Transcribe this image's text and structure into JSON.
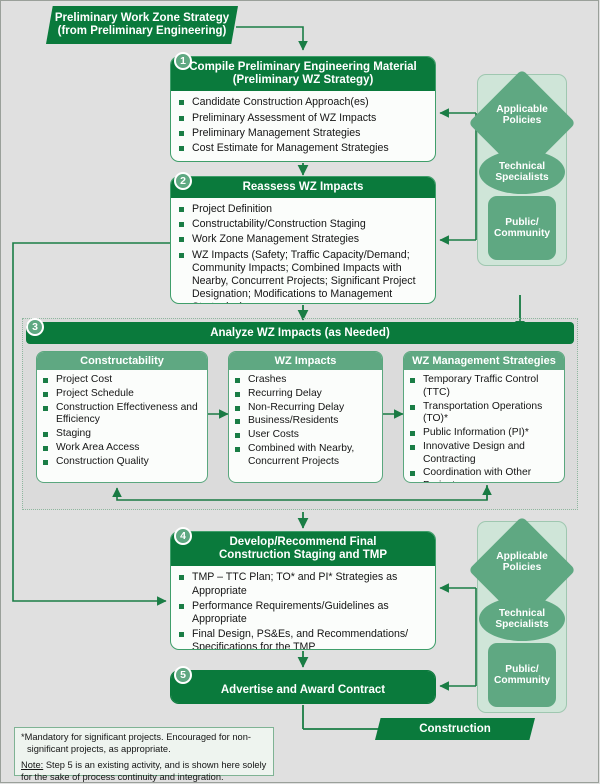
{
  "banners": {
    "top": "Preliminary Work Zone Strategy\n(from Preliminary Engineering)",
    "top_line1": "Preliminary Work Zone Strategy",
    "top_line2": "(from Preliminary Engineering)",
    "construction": "Construction"
  },
  "steps": [
    {
      "number": "1",
      "title_line1": "Compile Preliminary Engineering Material",
      "title_line2": "(Preliminary WZ Strategy)",
      "items": [
        "Candidate Construction Approach(es)",
        "Preliminary Assessment of WZ Impacts",
        "Preliminary Management Strategies",
        "Cost Estimate for Management Strategies"
      ]
    },
    {
      "number": "2",
      "title_line1": "Reassess WZ Impacts",
      "title_line2": "",
      "items": [
        "Project Definition",
        "Constructability/Construction Staging",
        "Work Zone Management Strategies",
        "WZ Impacts (Safety; Traffic Capacity/Demand; Community Impacts; Combined Impacts with Nearby, Concurrent Projects; Significant Project Designation; Modifications to Management Strategies)"
      ]
    },
    {
      "number": "3",
      "title_line1": "Analyze WZ Impacts (as Needed)",
      "title_line2": "",
      "items": []
    },
    {
      "number": "4",
      "title_line1": "Develop/Recommend Final",
      "title_line2": "Construction Staging and TMP",
      "items": [
        "TMP – TTC Plan; TO* and PI* Strategies as Appropriate",
        "Performance Requirements/Guidelines as Appropriate",
        "Final Design, PS&Es, and Recommendations/ Specifications for the TMP"
      ]
    },
    {
      "number": "5",
      "title_line1": "Advertise and Award Contract",
      "title_line2": "",
      "items": []
    }
  ],
  "step3_subpanels": [
    {
      "title": "Constructability",
      "items": [
        "Project Cost",
        "Project Schedule",
        "Construction Effectiveness and Efficiency",
        "Staging",
        "Work Area Access",
        "Construction Quality"
      ]
    },
    {
      "title": "WZ Impacts",
      "items": [
        "Crashes",
        "Recurring Delay",
        "Non-Recurring Delay",
        "Business/Residents",
        "User Costs",
        "Combined with Nearby, Concurrent Projects"
      ]
    },
    {
      "title": "WZ Management Strategies",
      "items": [
        "Temporary Traffic Control (TTC)",
        "Transportation Operations (TO)*",
        "Public Information (PI)*",
        "Innovative Design and Contracting",
        "Coordination with Other Projects"
      ]
    }
  ],
  "resources": {
    "top": {
      "diamond": "Applicable\nPolicies",
      "diamond_line1": "Applicable",
      "diamond_line2": "Policies",
      "ellipse_line1": "Technical",
      "ellipse_line2": "Specialists",
      "rect_line1": "Public/",
      "rect_line2": "Community"
    },
    "bottom": {
      "diamond_line1": "Applicable",
      "diamond_line2": "Policies",
      "ellipse_line1": "Technical",
      "ellipse_line2": "Specialists",
      "rect_line1": "Public/",
      "rect_line2": "Community"
    }
  },
  "footnote": {
    "line1": "*Mandatory for significant projects.  Encouraged for non-significant projects, as appropriate.",
    "note_label": "Note:",
    "note_text": " Step 5 is an existing activity, and is shown here solely for the sake of process continuity and integration."
  },
  "colors": {
    "dark_green": "#0a7a3c",
    "mid_green": "#5fa882",
    "light_green_panel": "#cfe5d8",
    "page_background": "#e0e0e0",
    "arrow_green": "#1a7d45",
    "box_fill": "#fbfdfb"
  }
}
